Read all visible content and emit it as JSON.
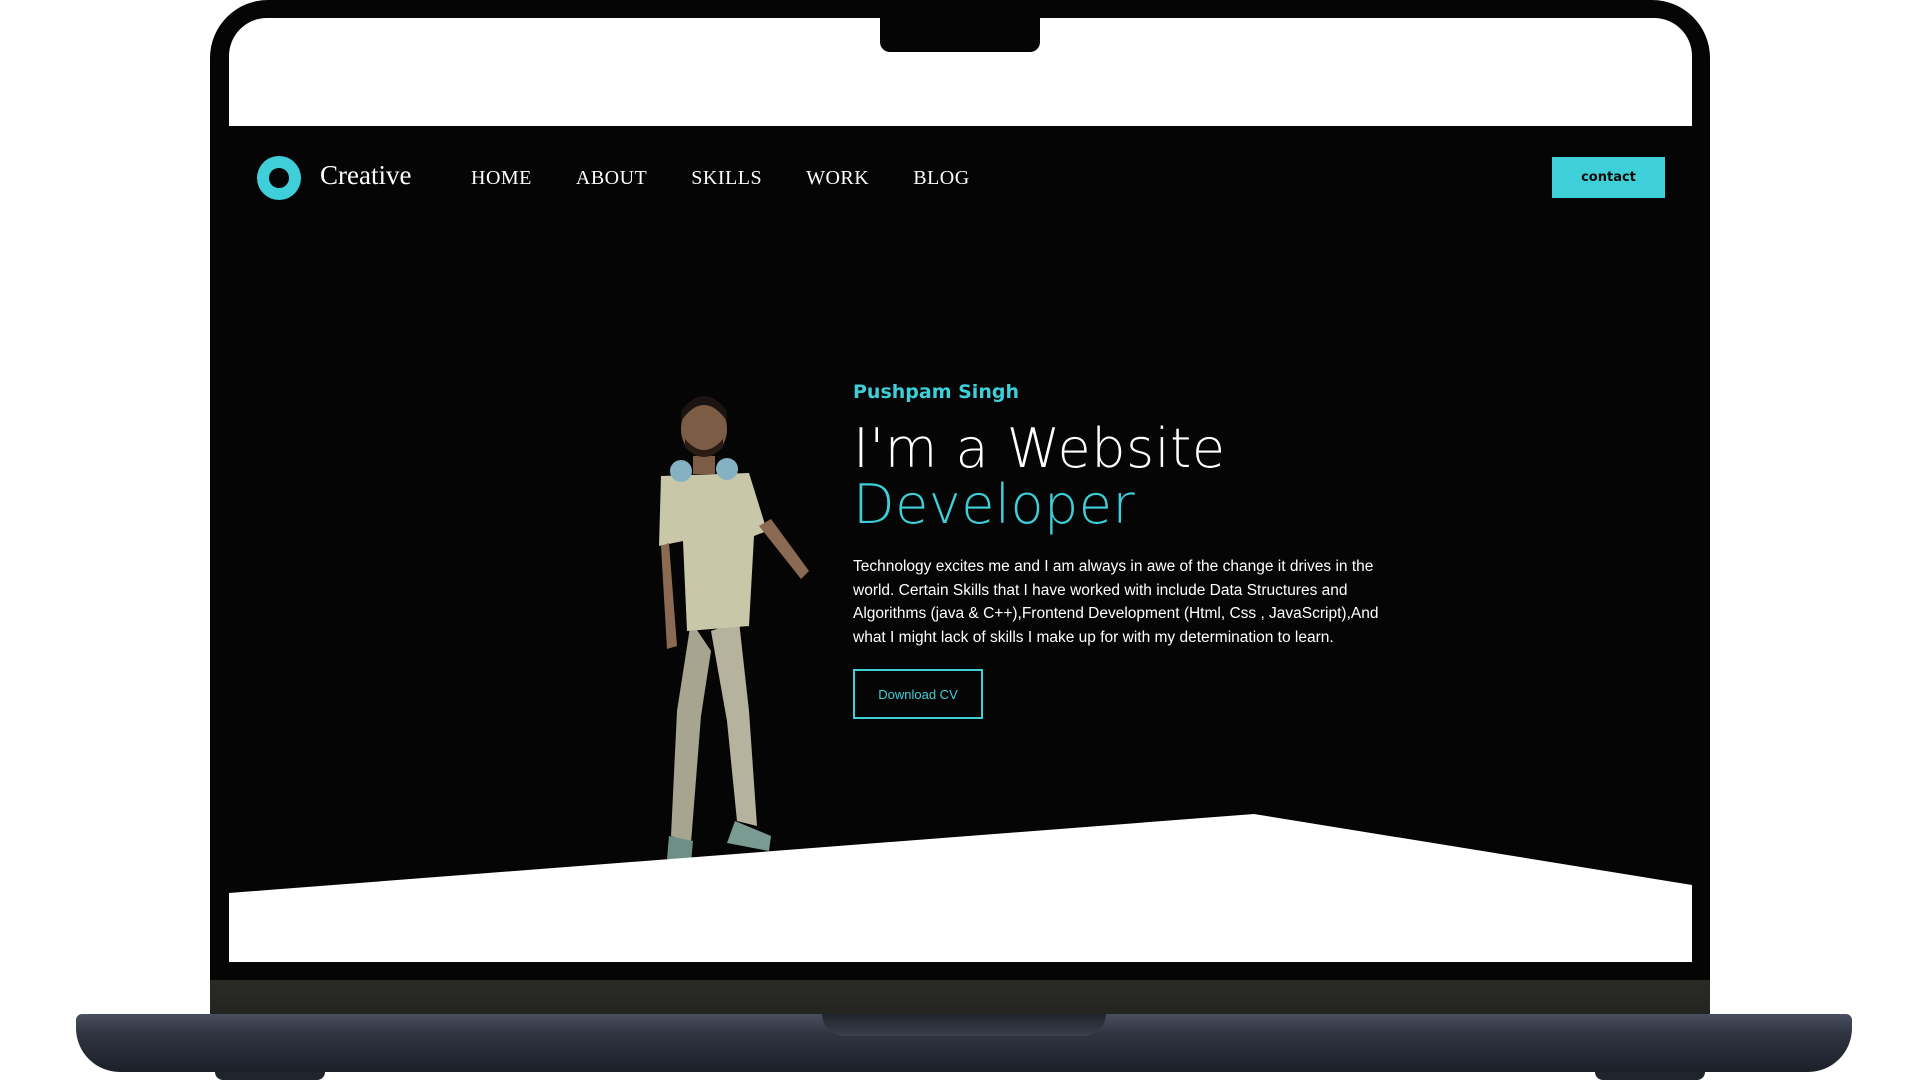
{
  "brand": {
    "name": "Creative",
    "accent_color": "#3ecfd8"
  },
  "nav": {
    "items": [
      {
        "label": "HOME"
      },
      {
        "label": "ABOUT"
      },
      {
        "label": "SKILLS"
      },
      {
        "label": "WORK"
      },
      {
        "label": "BLOG"
      }
    ],
    "contact_label": "contact"
  },
  "hero": {
    "name": "Pushpam Singh",
    "title_line1": "I'm a Website",
    "title_line2": "Developer",
    "description": "Technology excites me and I am always in awe of the change it drives in the world. Certain Skills that I have worked with include Data Structures and Algorithms (java & C++),Frontend Development (Html, Css , JavaScript),And what I might lack of skills I make up for with my determination to learn.",
    "cta_label": "Download CV",
    "portrait": "person-portrait"
  },
  "colors": {
    "background": "#050505",
    "text": "#ffffff",
    "accent": "#3ecfd8"
  }
}
